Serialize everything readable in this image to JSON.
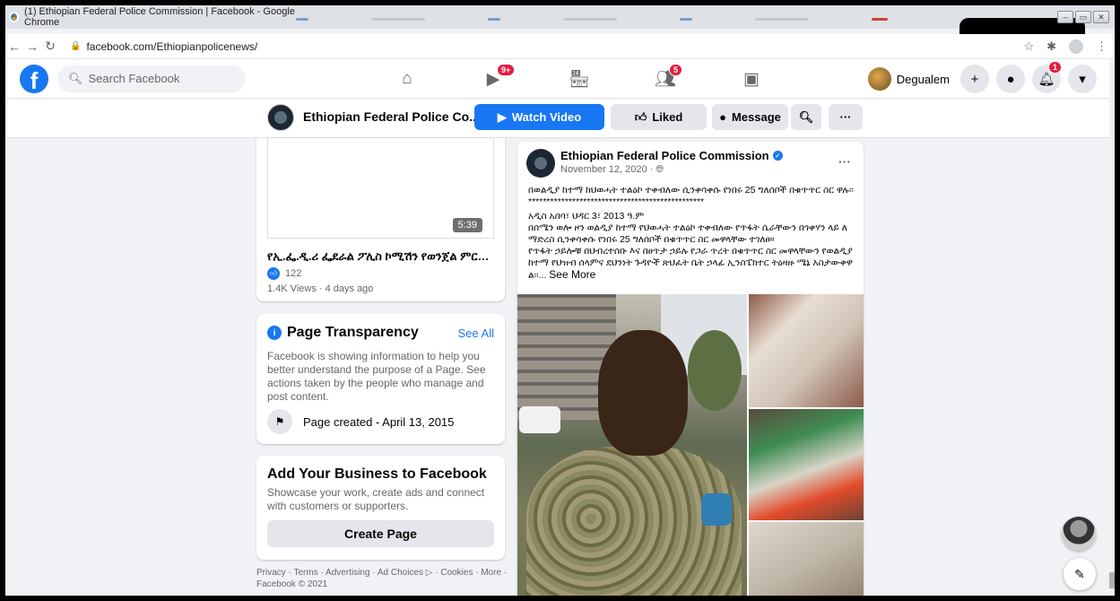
{
  "browser": {
    "tab_title": "(1) Ethiopian Federal Police Commission | Facebook - Google Chrome",
    "url": "facebook.com/Ethiopianpolicenews/"
  },
  "fb_header": {
    "search_placeholder": "Search Facebook",
    "nav_badges": {
      "watch": "9+",
      "groups": "5"
    },
    "profile_name": "Degualem",
    "notifications_badge": "1"
  },
  "page_bar": {
    "page_name": "Ethiopian Federal Police Co...",
    "watch_label": "Watch Video",
    "liked_label": "Liked",
    "message_label": "Message"
  },
  "video_card": {
    "duration": "5:39",
    "title": "የኢ.ፌ.ዲ.ሪ ፌደራል ፖሊስ ኮሚሽን የወንጀል ምርመራ ...",
    "likes": "122",
    "meta": "1.4K Views · 4 days ago"
  },
  "transparency": {
    "heading": "Page Transparency",
    "see_all": "See All",
    "description": "Facebook is showing information to help you better understand the purpose of a Page. See actions taken by the people who manage and post content.",
    "created": "Page created - April 13, 2015"
  },
  "business": {
    "heading": "Add Your Business to Facebook",
    "description": "Showcase your work, create ads and connect with customers or supporters.",
    "button": "Create Page"
  },
  "footer": {
    "links": "Privacy · Terms · Advertising · Ad Choices ▷ · Cookies · More ·",
    "copyright": "Facebook © 2021"
  },
  "post": {
    "author": "Ethiopian Federal Police Commission",
    "date": "November 12, 2020 · ",
    "line1": "በወልዲያ ከተማ ከህወሓት ተልዕኮ ተቀብለው ሲንቀሳቀሱ የነበሩ 25 ግለሰቦች በቁጥጥር ስር ዋሉ፡፡ ************************************************",
    "line2": "አዲስ አበባ፣ ህዳር 3፣ 2013 ዓ.ም",
    "line3": " በሰሜን ወሎ ዞን ወልዲያ ከተማ የህወሓት ተልዕኮ ተቀብለው የጥፋት ሴራቸውን በጎቀሃን ላይ ለማድረስ ሲንቀሳቀሱ የነበሩ 25 ግለሰቦች በቁጥጥር ስር መዋላቸው ተገለፀ።",
    "line4": "የጥፋት ኃይሎቹ በህብረተሰቡ እና በፀጥታ ኃይሉ የጋራ ጥረት በቁጥጥር ስር መዋላቸውን የወልዲያ ከተማ የህዝብ ሰላምና ደህንነት ጉዳዮች ጽህፈት ቤት ኃላፊ ኢንስፔክተር ትዕዛዙ ሜኔ አስታውቀዋል፡፡...",
    "see_more": "See More"
  }
}
